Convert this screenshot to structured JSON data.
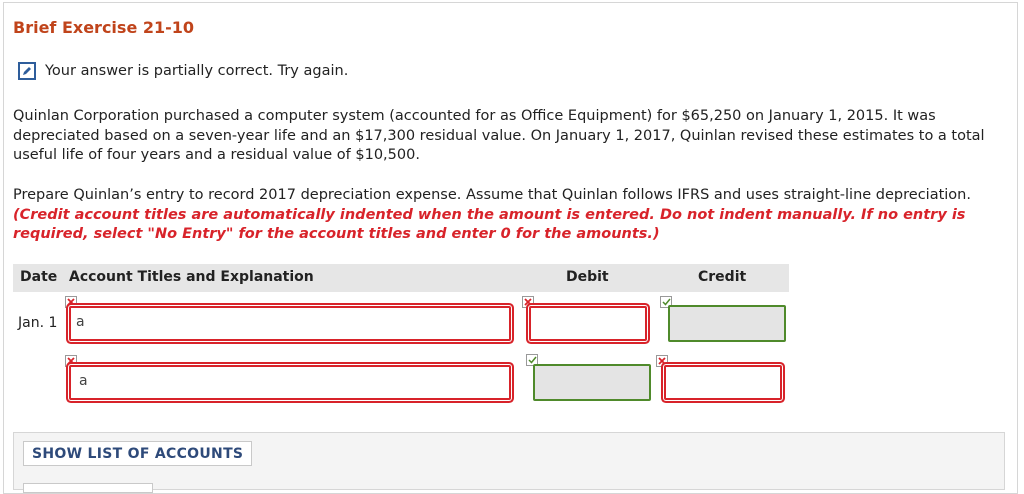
{
  "exercise": {
    "title": "Brief Exercise 21-10"
  },
  "status": {
    "text": "Your answer is partially correct.  Try again.",
    "icon": "pencil-edit-icon"
  },
  "question": {
    "para1": "Quinlan Corporation purchased a computer system (accounted for as Office Equipment) for $65,250 on January 1, 2015. It was depreciated based on a seven-year life and an $17,300 residual value. On January 1, 2017, Quinlan revised these estimates to a total useful life of four years and a residual value of $10,500.",
    "para2_plain": "Prepare Quinlan’s entry to record 2017 depreciation expense. Assume that Quinlan follows IFRS and uses straight-line depreciation. ",
    "para2_instruction": "(Credit account titles are automatically indented when the amount is entered. Do not indent manually. If no entry is required, select \"No Entry\" for the account titles and enter 0 for the amounts.)"
  },
  "table": {
    "headers": {
      "date": "Date",
      "account": "Account Titles and Explanation",
      "debit": "Debit",
      "credit": "Credit"
    },
    "rows": [
      {
        "date": "Jan. 1",
        "account": "a",
        "debit": "",
        "credit": "",
        "account_status": "incorrect",
        "debit_status": "incorrect",
        "credit_status": "correct"
      },
      {
        "date": "",
        "account": "a",
        "debit": "",
        "credit": "",
        "account_status": "incorrect",
        "debit_status": "correct",
        "credit_status": "incorrect"
      }
    ]
  },
  "colors": {
    "title": "#c0441b",
    "incorrect": "#d8232a",
    "correct": "#4f8a2b",
    "link": "#2e4a7a"
  },
  "buttons": {
    "show_accounts": "SHOW LIST OF ACCOUNTS"
  }
}
